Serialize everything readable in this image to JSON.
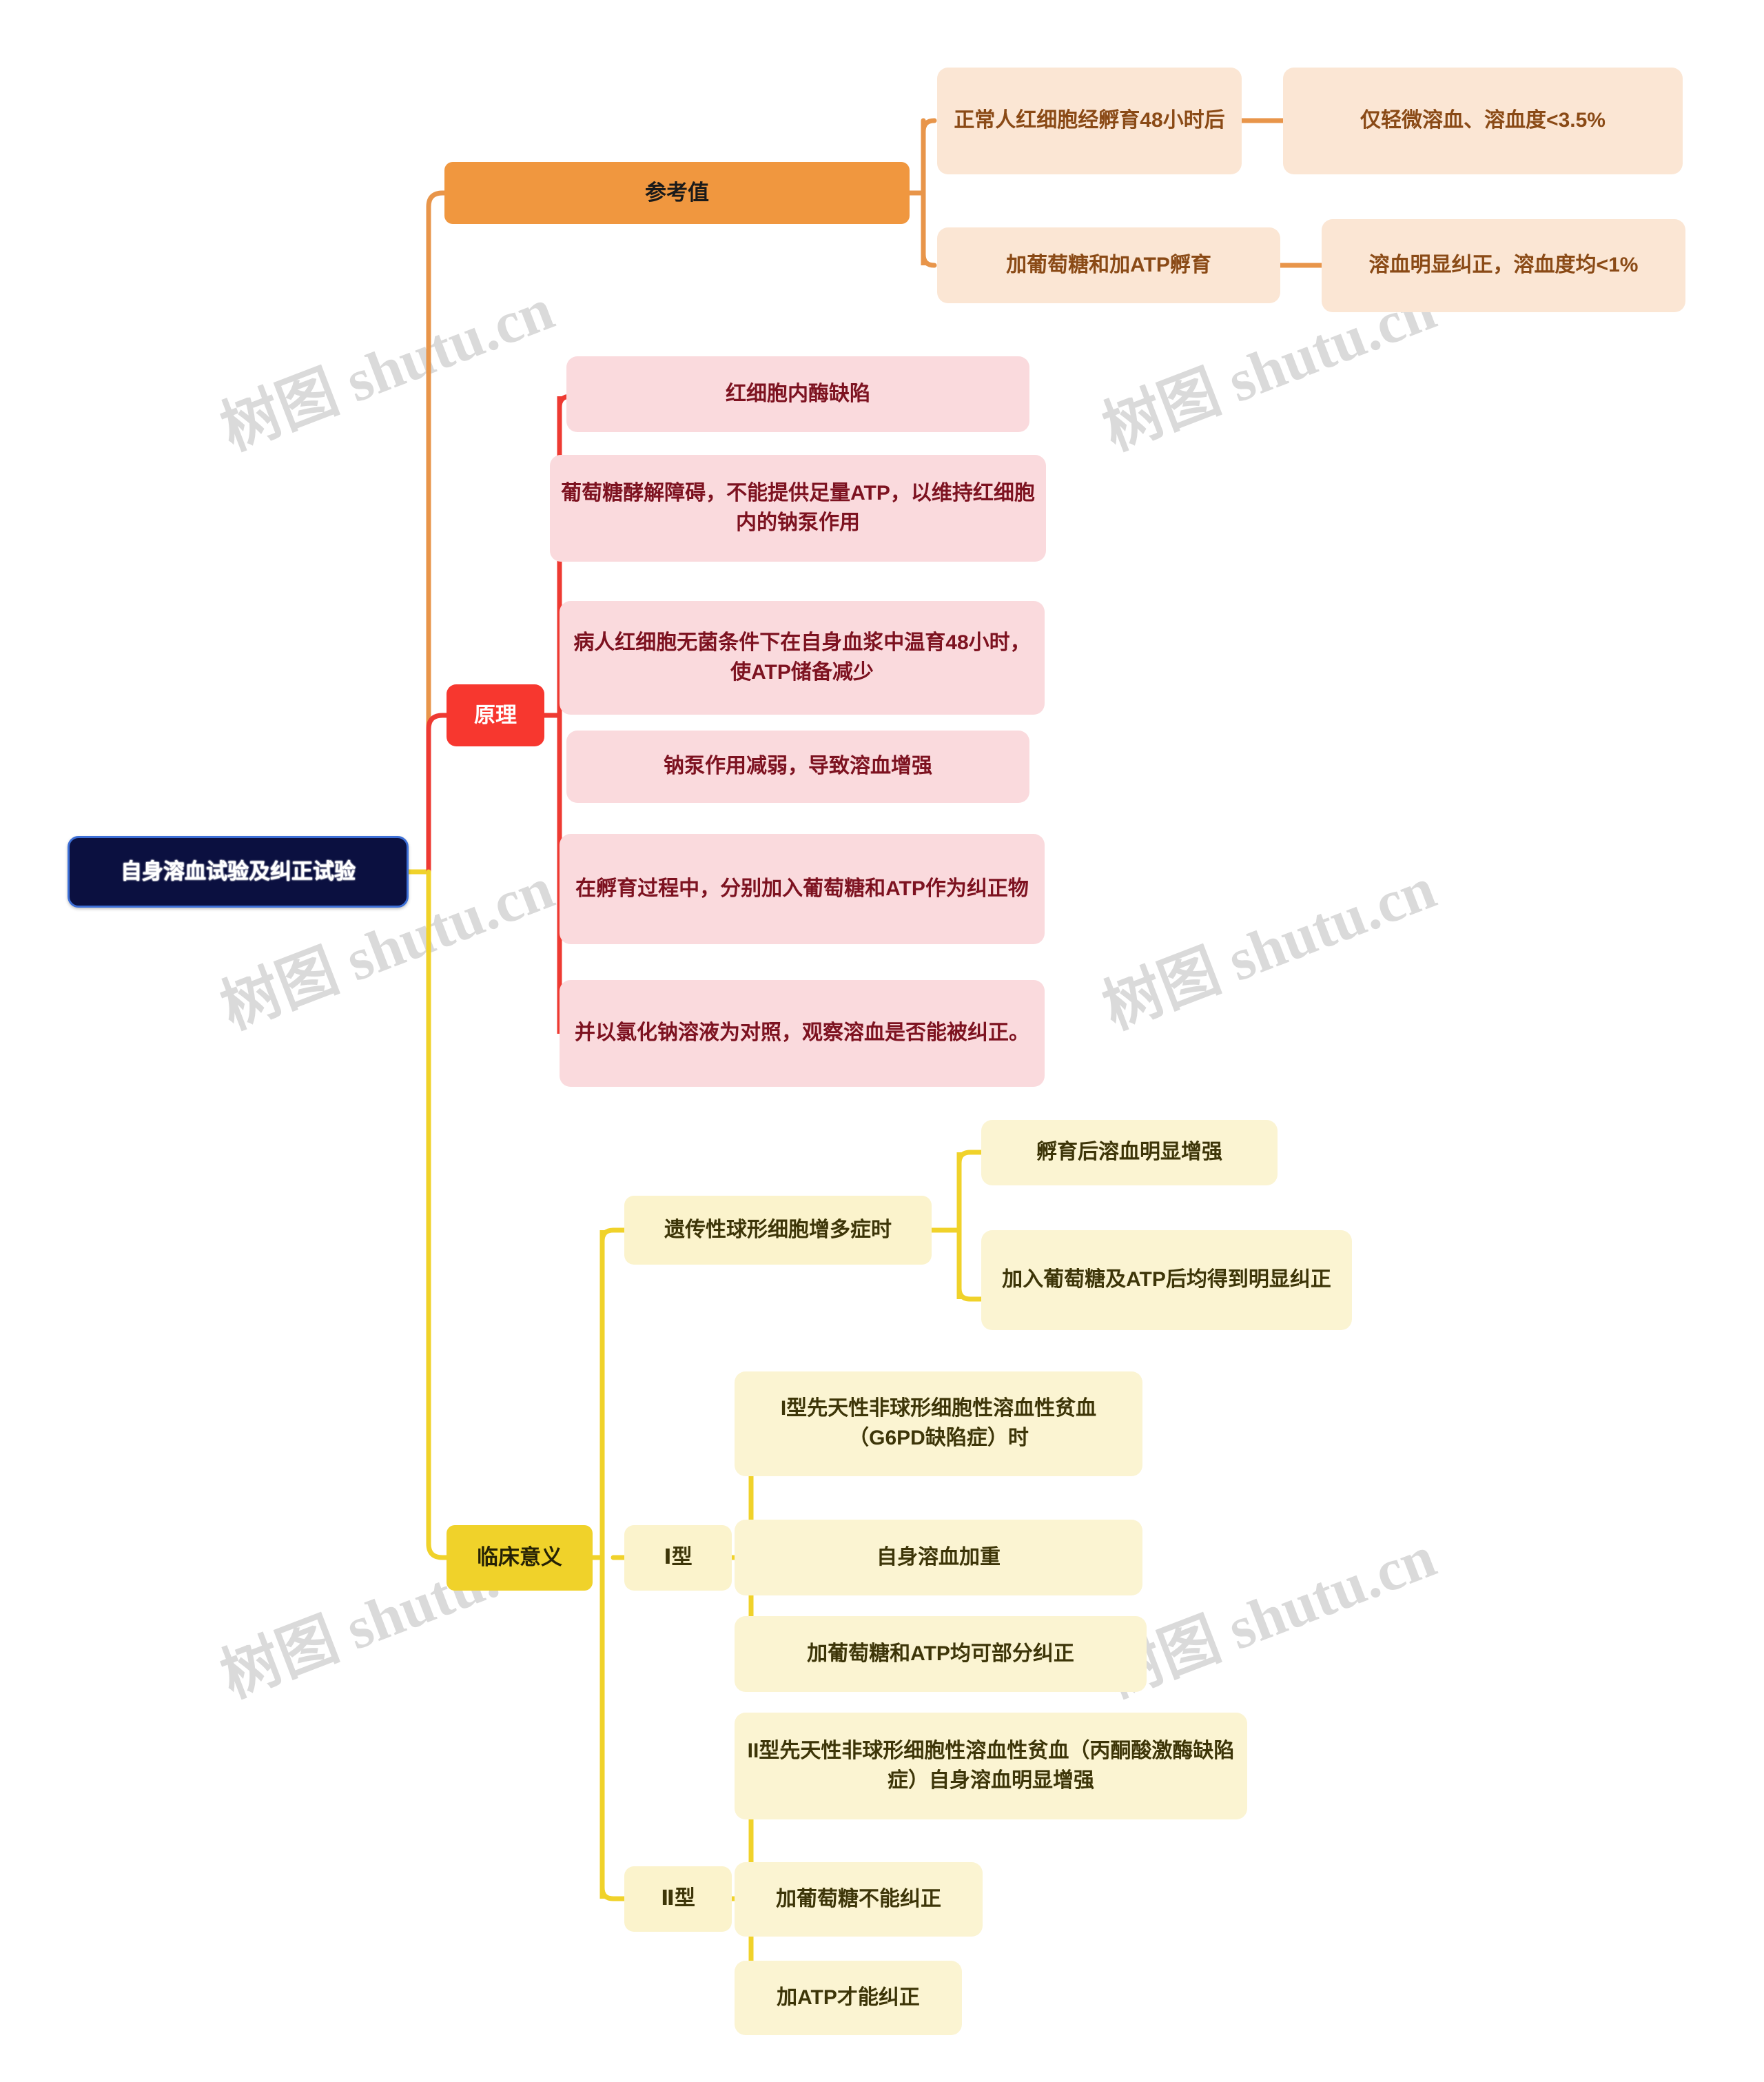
{
  "root": {
    "label": "自身溶血试验及纠正试验"
  },
  "watermark": {
    "text": "树图 shutu.cn"
  },
  "branches": [
    {
      "id": "reference",
      "label": "参考值",
      "color": "#f0973f",
      "children": [
        {
          "label": "正常人红细胞经孵育48小时后",
          "children": [
            {
              "label": "仅轻微溶血、溶血度<3.5%"
            }
          ]
        },
        {
          "label": "加葡萄糖和加ATP孵育",
          "children": [
            {
              "label": "溶血明显纠正，溶血度均<1%"
            }
          ]
        }
      ]
    },
    {
      "id": "principle",
      "label": "原理",
      "color": "#f7372f",
      "children": [
        {
          "label": "红细胞内酶缺陷"
        },
        {
          "label": "葡萄糖酵解障碍，不能提供足量ATP，以维持红细胞内的钠泵作用"
        },
        {
          "label": "病人红细胞无菌条件下在自身血浆中温育48小时，使ATP储备减少"
        },
        {
          "label": "钠泵作用减弱，导致溶血增强"
        },
        {
          "label": "在孵育过程中，分别加入葡萄糖和ATP作为纠正物"
        },
        {
          "label": "并以氯化钠溶液为对照，观察溶血是否能被纠正。"
        }
      ]
    },
    {
      "id": "clinical",
      "label": "临床意义",
      "color": "#f0d22a",
      "children": [
        {
          "label": "遗传性球形细胞增多症时",
          "children": [
            {
              "label": "孵育后溶血明显增强"
            },
            {
              "label": "加入葡萄糖及ATP后均得到明显纠正"
            }
          ]
        },
        {
          "label": "Ⅰ型",
          "children": [
            {
              "label": "I型先天性非球形细胞性溶血性贫血（G6PD缺陷症）时"
            },
            {
              "label": "自身溶血加重"
            },
            {
              "label": "加葡萄糖和ATP均可部分纠正"
            }
          ]
        },
        {
          "label": "Ⅱ型",
          "children": [
            {
              "label": "II型先天性非球形细胞性溶血性贫血（丙酮酸激酶缺陷症）自身溶血明显增强"
            },
            {
              "label": "加葡萄糖不能纠正"
            },
            {
              "label": "加ATP才能纠正"
            }
          ]
        }
      ]
    }
  ]
}
